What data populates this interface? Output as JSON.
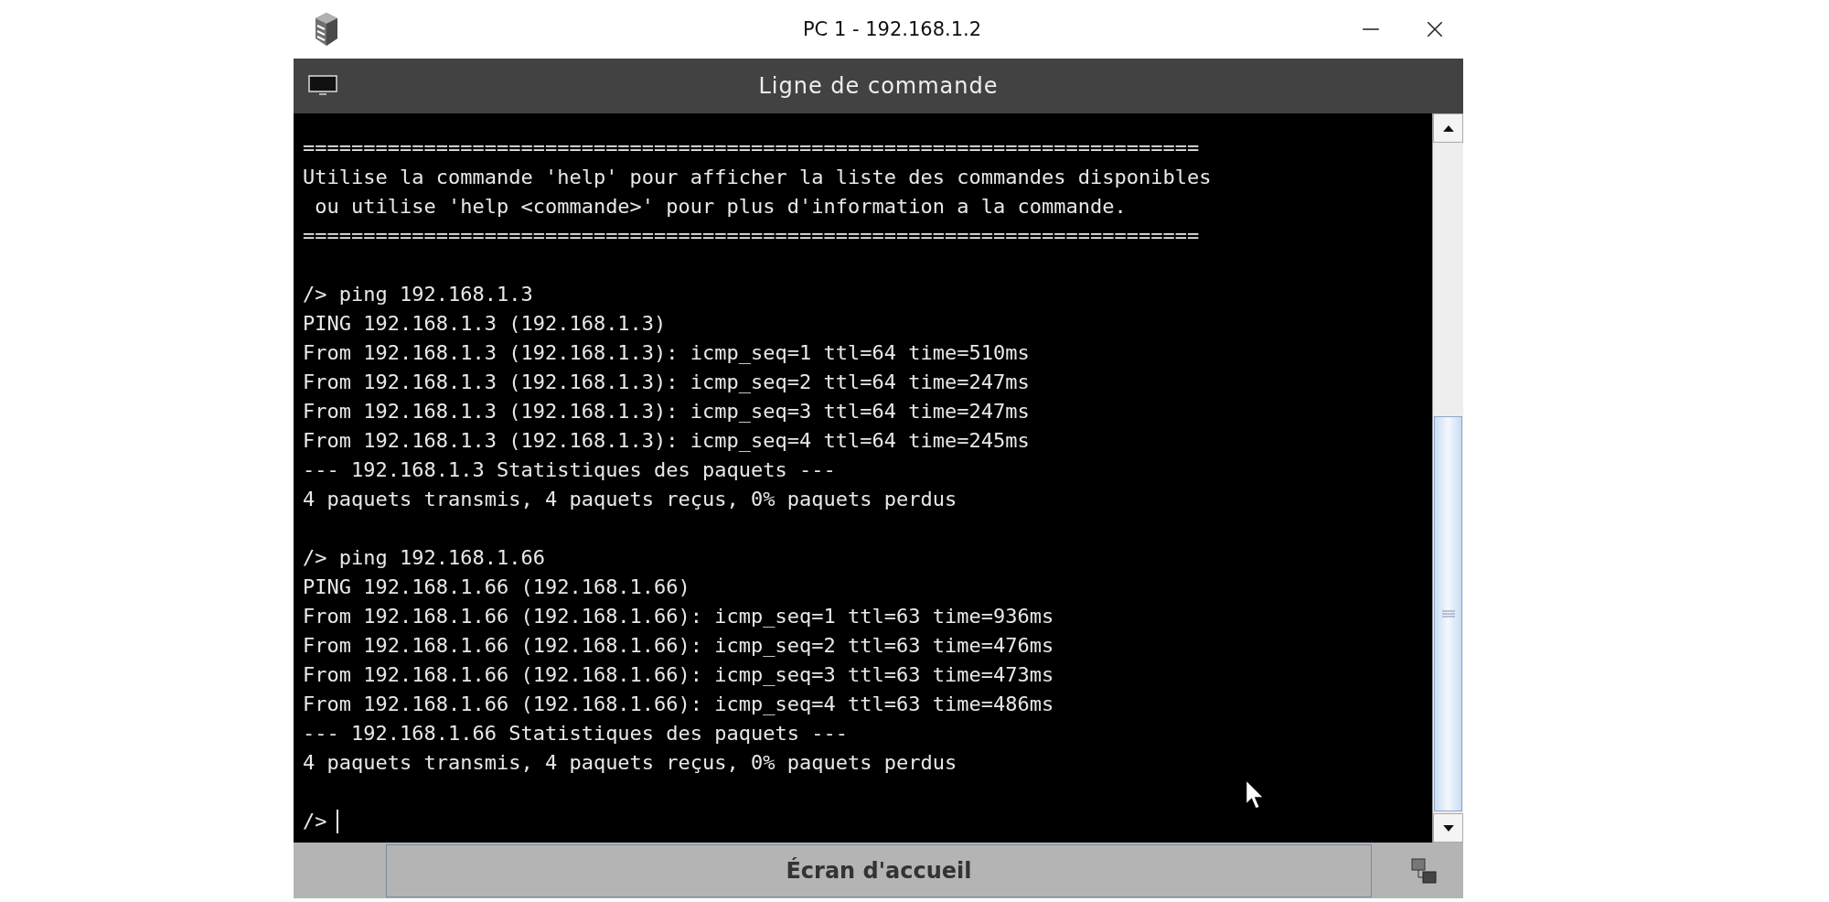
{
  "window": {
    "title": "PC 1 - 192.168.1.2"
  },
  "header": {
    "title": "Ligne de commande"
  },
  "terminal": {
    "blocks": [
      [
        "==========================================================================",
        "Utilise la commande 'help' pour afficher la liste des commandes disponibles",
        " ou utilise 'help <commande>' pour plus d'information a la commande.",
        "=========================================================================="
      ],
      [
        "/> ping 192.168.1.3",
        "PING 192.168.1.3 (192.168.1.3)",
        "From 192.168.1.3 (192.168.1.3): icmp_seq=1 ttl=64 time=510ms",
        "From 192.168.1.3 (192.168.1.3): icmp_seq=2 ttl=64 time=247ms",
        "From 192.168.1.3 (192.168.1.3): icmp_seq=3 ttl=64 time=247ms",
        "From 192.168.1.3 (192.168.1.3): icmp_seq=4 ttl=64 time=245ms",
        "--- 192.168.1.3 Statistiques des paquets ---",
        "4 paquets transmis, 4 paquets reçus, 0% paquets perdus"
      ],
      [
        "/> ping 192.168.1.66",
        "PING 192.168.1.66 (192.168.1.66)",
        "From 192.168.1.66 (192.168.1.66): icmp_seq=1 ttl=63 time=936ms",
        "From 192.168.1.66 (192.168.1.66): icmp_seq=2 ttl=63 time=476ms",
        "From 192.168.1.66 (192.168.1.66): icmp_seq=3 ttl=63 time=473ms",
        "From 192.168.1.66 (192.168.1.66): icmp_seq=4 ttl=63 time=486ms",
        "--- 192.168.1.66 Statistiques des paquets ---",
        "4 paquets transmis, 4 paquets reçus, 0% paquets perdus"
      ]
    ],
    "prompt": "/>"
  },
  "bottom_bar": {
    "button": "Écran d'accueil"
  }
}
